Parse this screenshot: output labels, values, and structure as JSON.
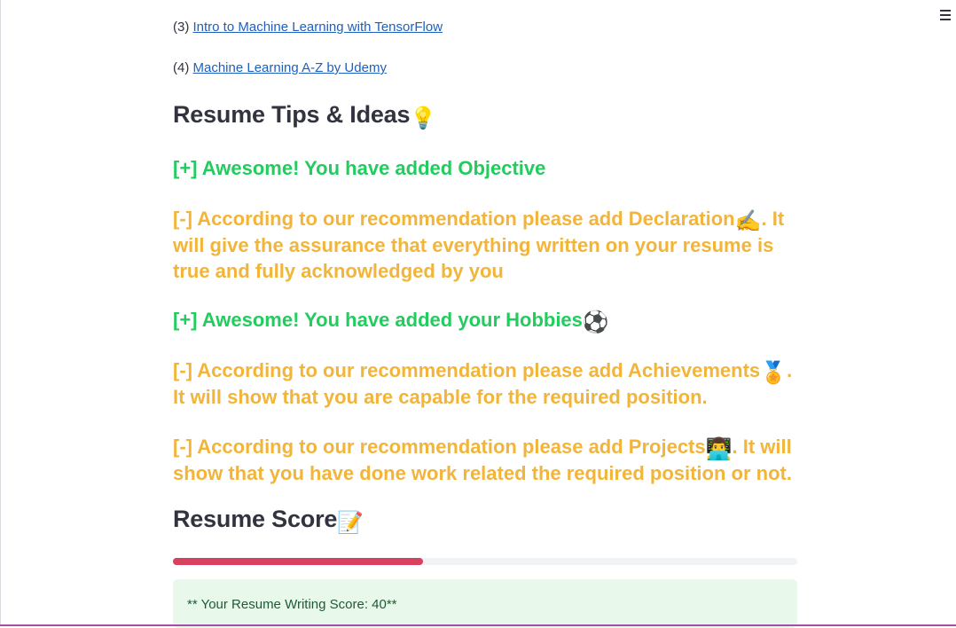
{
  "links": [
    {
      "prefix": "(3) ",
      "text": "Intro to Machine Learning with TensorFlow"
    },
    {
      "prefix": "(4) ",
      "text": "Machine Learning A-Z by Udemy"
    }
  ],
  "tips_section": {
    "title": "Resume Tips & Ideas",
    "title_emoji": "💡",
    "items": [
      {
        "text": "[+] Awesome! You have added Objective",
        "status": "added"
      },
      {
        "text_before": "[-] According to our recommendation please add Declaration",
        "emoji": "✍",
        "text_after": ". It will give the assurance that everything written on your resume is true and fully acknowledged by you",
        "status": "missing"
      },
      {
        "text_before": "[+] Awesome! You have added your Hobbies",
        "emoji": "⚽",
        "text_after": "",
        "status": "added"
      },
      {
        "text_before": "[-] According to our recommendation please add Achievements",
        "emoji": "🏅",
        "text_after": ". It will show that you are capable for the required position.",
        "status": "missing"
      },
      {
        "text_before": "[-] According to our recommendation please add Projects",
        "emoji": "👨‍💻",
        "text_after": ". It will show that you have done work related the required position or not.",
        "status": "missing"
      }
    ]
  },
  "score_section": {
    "title": "Resume Score",
    "title_emoji": "📝",
    "progress": 0.4,
    "score_text": "** Your Resume Writing Score: 40**"
  },
  "colors": {
    "added": "#22cc5e",
    "missing": "#f2b53a",
    "progress_fill": "#d8405f",
    "link": "#1f5fbf"
  },
  "icons": {
    "menu": "hamburger-menu-icon"
  }
}
